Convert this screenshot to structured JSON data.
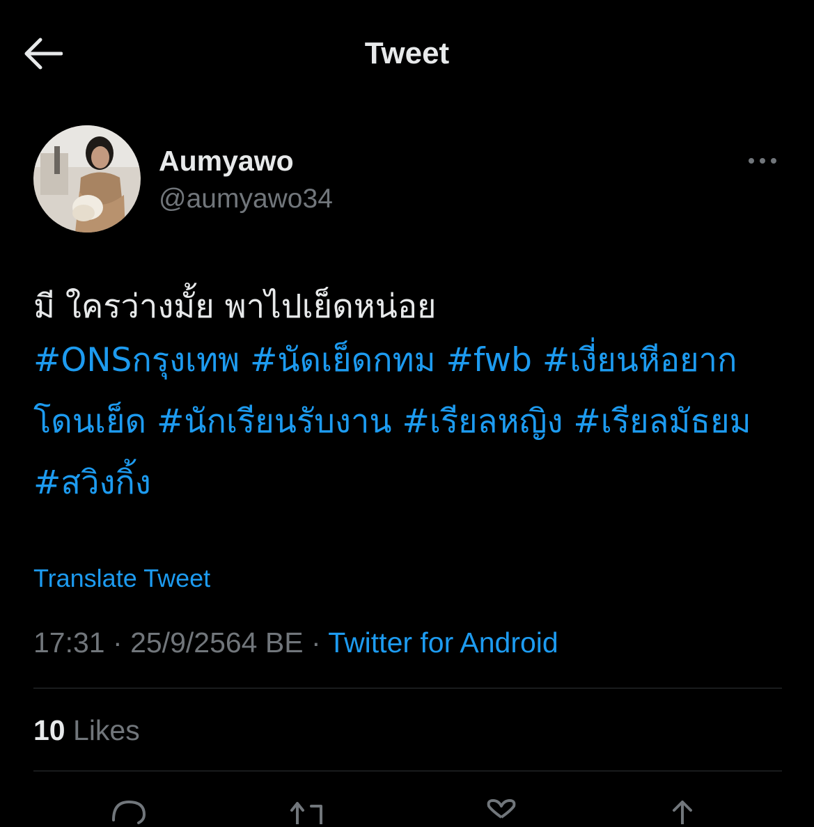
{
  "header": {
    "title": "Tweet",
    "back_icon": "arrow-left-icon"
  },
  "author": {
    "display_name": "Aumyawo",
    "handle": "@aumyawo34"
  },
  "tweet": {
    "text": "มี ใครว่างมั้ย พาไปเย็ดหน่อย",
    "hashtags": [
      "#ONSกรุงเทพ",
      "#นัดเย็ดกทม",
      "#fwb",
      "#เงี่ยนหีอยากโดนเย็ด",
      "#นักเรียนรับงาน",
      "#เรียลหญิง",
      "#เรียลมัธยม",
      "#สวิงกิ้ง"
    ],
    "translate_label": "Translate Tweet",
    "time": "17:31",
    "date": "25/9/2564 BE",
    "separator": "·",
    "source": "Twitter for Android"
  },
  "stats": {
    "likes_count": "10",
    "likes_label": "Likes"
  },
  "actions": [
    "reply-icon",
    "retweet-icon",
    "like-icon",
    "share-icon"
  ],
  "colors": {
    "background": "#000000",
    "text": "#e7e9ea",
    "secondary": "#71767b",
    "accent": "#1d9bf0",
    "divider": "#2f3336"
  }
}
